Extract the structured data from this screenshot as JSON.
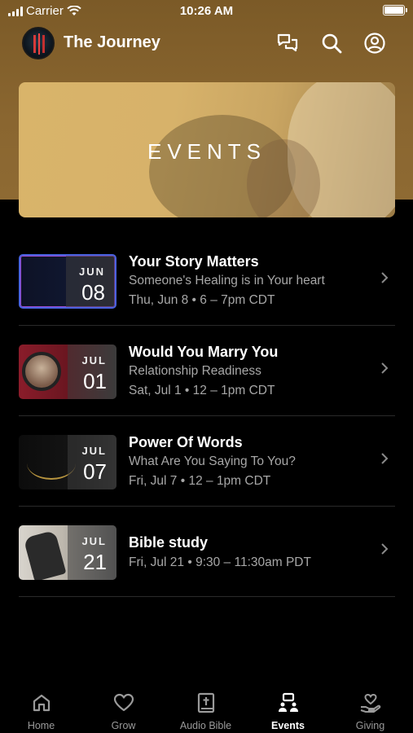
{
  "status": {
    "carrier": "Carrier",
    "time": "10:26 AM"
  },
  "header": {
    "title": "The Journey"
  },
  "banner": {
    "title": "EVENTS"
  },
  "events": [
    {
      "title": "Your Story Matters",
      "subtitle": "Someone's Healing is in Your heart",
      "time": "Thu, Jun 8 • 6 – 7pm CDT",
      "month": "JUN",
      "day": "08"
    },
    {
      "title": "Would You Marry You",
      "subtitle": "Relationship Readiness",
      "time": "Sat, Jul 1 • 12 – 1pm CDT",
      "month": "JUL",
      "day": "01"
    },
    {
      "title": "Power Of Words",
      "subtitle": "What Are You Saying To You?",
      "time": "Fri, Jul 7 • 12 – 1pm CDT",
      "month": "JUL",
      "day": "07"
    },
    {
      "title": "Bible study",
      "subtitle": "",
      "time": "Fri, Jul 21 • 9:30 – 11:30am PDT",
      "month": "JUL",
      "day": "21"
    }
  ],
  "tabs": [
    {
      "label": "Home",
      "icon": "home-icon"
    },
    {
      "label": "Grow",
      "icon": "heart-icon"
    },
    {
      "label": "Audio Bible",
      "icon": "bible-icon"
    },
    {
      "label": "Events",
      "icon": "events-icon",
      "active": true
    },
    {
      "label": "Giving",
      "icon": "giving-icon"
    }
  ],
  "colors": {
    "header_bg": "#8a6630",
    "background": "#000000",
    "muted_text": "#a7a7a7"
  }
}
